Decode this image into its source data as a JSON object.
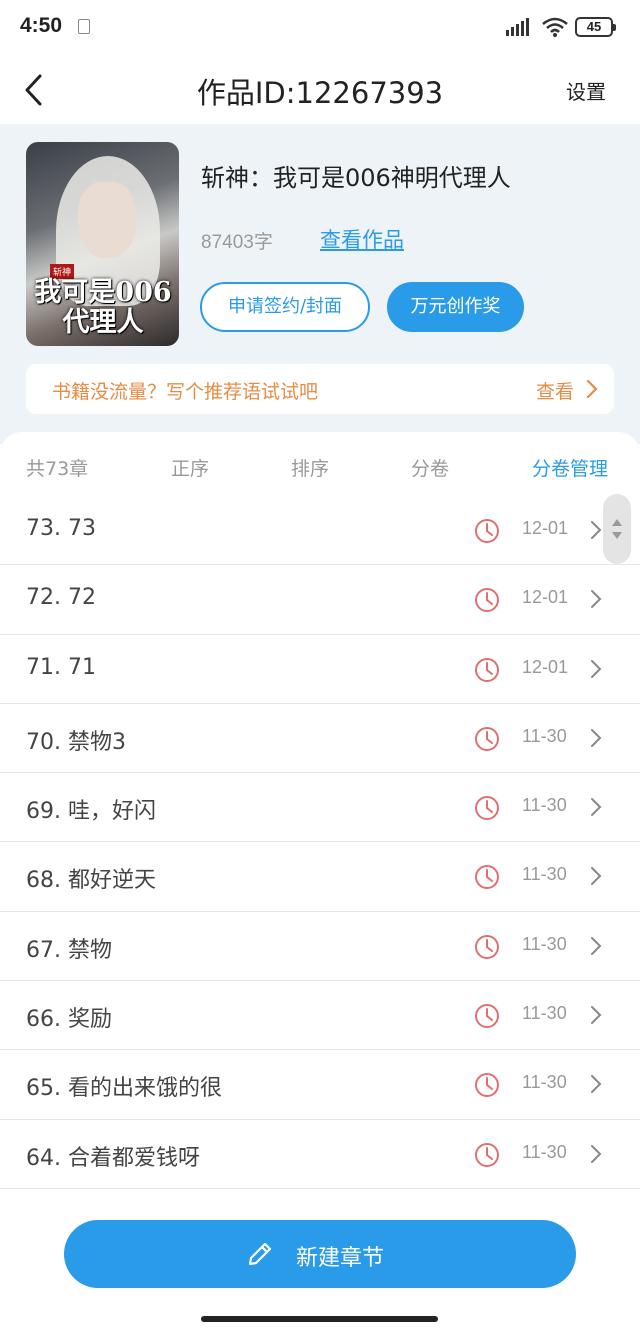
{
  "status": {
    "time": "4:50",
    "battery": "45"
  },
  "nav": {
    "title": "作品ID:12267393",
    "settings": "设置"
  },
  "book": {
    "title": "斩神：我可是006神明代理人",
    "word_count": "87403字",
    "view_work": "查看作品",
    "apply_button": "申请签约/封面",
    "award_button": "万元创作奖",
    "cover_title": "我可是006代理人",
    "cover_tag": "斩神"
  },
  "tip": {
    "text": "书籍没流量？写个推荐语试试吧",
    "view": "查看"
  },
  "list_header": {
    "total": "共73章",
    "order": "正序",
    "sort": "排序",
    "volume": "分卷",
    "manage": "分卷管理"
  },
  "chapters": [
    {
      "title": "73. 73",
      "date": "12-01"
    },
    {
      "title": "72. 72",
      "date": "12-01"
    },
    {
      "title": "71. 71",
      "date": "12-01"
    },
    {
      "title": "70. 禁物3",
      "date": "11-30"
    },
    {
      "title": "69. 哇，好闪",
      "date": "11-30"
    },
    {
      "title": "68. 都好逆天",
      "date": "11-30"
    },
    {
      "title": "67. 禁物",
      "date": "11-30"
    },
    {
      "title": "66. 奖励",
      "date": "11-30"
    },
    {
      "title": "65. 看的出来饿的很",
      "date": "11-30"
    },
    {
      "title": "64. 合着都爱钱呀",
      "date": "11-30"
    }
  ],
  "bottom": {
    "new_chapter": "新建章节"
  },
  "colors": {
    "accent": "#2a9be8",
    "tip": "#e58d44",
    "clock": "#e07070"
  }
}
